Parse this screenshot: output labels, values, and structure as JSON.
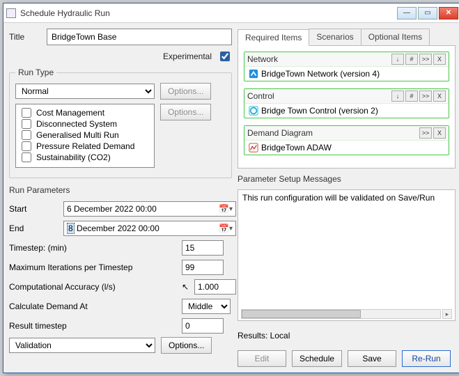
{
  "window": {
    "title": "Schedule Hydraulic Run"
  },
  "title": {
    "label": "Title",
    "value": "BridgeTown Base"
  },
  "experimental": {
    "label": "Experimental",
    "checked": true
  },
  "runType": {
    "legend": "Run Type",
    "selected": "Normal",
    "optionsBtn1": "Options...",
    "optionsBtn2": "Options...",
    "flags": [
      {
        "label": "Cost Management",
        "checked": false
      },
      {
        "label": "Disconnected System",
        "checked": false
      },
      {
        "label": "Generalised Multi Run",
        "checked": false
      },
      {
        "label": "Pressure Related Demand",
        "checked": false
      },
      {
        "label": "Sustainability (CO2)",
        "checked": false
      }
    ]
  },
  "runParams": {
    "legend": "Run Parameters",
    "start": {
      "label": "Start",
      "value": "6 December 2022 00:00"
    },
    "end": {
      "label": "End",
      "value_prefix": "8",
      "value_rest": " December 2022 00:00"
    },
    "timestep": {
      "label": "Timestep: (min)",
      "value": "15"
    },
    "maxIter": {
      "label": "Maximum Iterations per Timestep",
      "value": "99"
    },
    "compAcc": {
      "label": "Computational Accuracy (l/s)",
      "value": "1.000"
    },
    "calcDemand": {
      "label": "Calculate Demand At",
      "value": "Middle"
    },
    "resultTs": {
      "label": "Result timestep",
      "value": "0"
    },
    "mode": {
      "value": "Validation",
      "optionsBtn": "Options..."
    }
  },
  "tabs": {
    "required": "Required Items",
    "scenarios": "Scenarios",
    "optional": "Optional Items"
  },
  "required": {
    "network": {
      "heading": "Network",
      "item": "BridgeTown Network (version 4)",
      "buttons": [
        "↓",
        "#",
        ">>",
        "X"
      ]
    },
    "control": {
      "heading": "Control",
      "item": "Bridge Town Control (version 2)",
      "buttons": [
        "↓",
        "#",
        ">>",
        "X"
      ]
    },
    "demand": {
      "heading": "Demand Diagram",
      "item": "BridgeTown ADAW",
      "buttons": [
        ">>",
        "X"
      ]
    }
  },
  "paramMessages": {
    "heading": "Parameter Setup Messages",
    "text": "This run configuration will be validated on Save/Run"
  },
  "results": {
    "label": "Results: Local"
  },
  "footerButtons": {
    "edit": "Edit",
    "schedule": "Schedule",
    "save": "Save",
    "rerun": "Re-Run"
  }
}
